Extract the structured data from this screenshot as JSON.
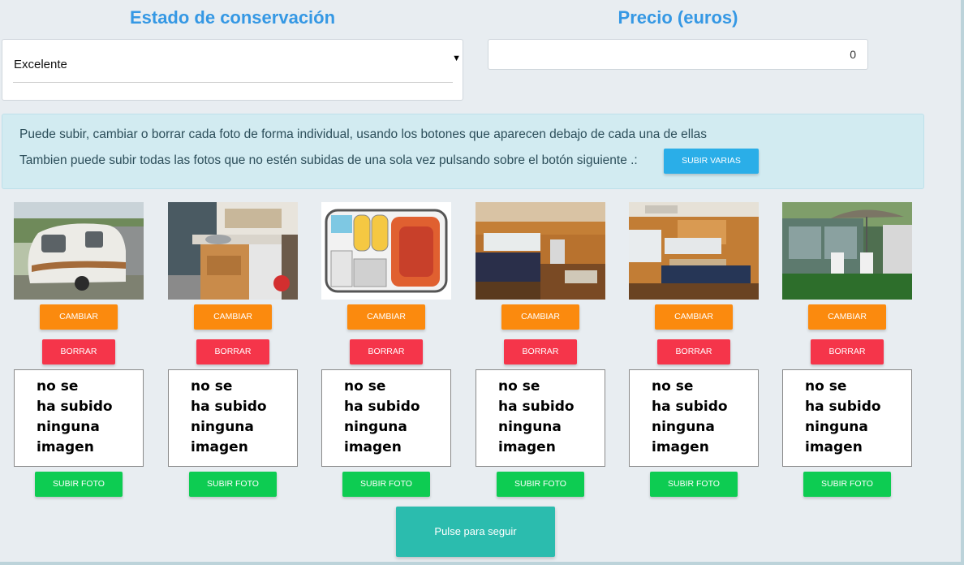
{
  "condition": {
    "title": "Estado de conservación",
    "selected": "Excelente"
  },
  "price": {
    "title": "Precio (euros)",
    "value": "0"
  },
  "info": {
    "line1": "Puede subir, cambiar o borrar cada foto de forma individual, usando los botones que aparecen debajo de cada una de ellas",
    "line2": "Tambien puede subir todas las fotos que no estén subidas de una sola vez pulsando sobre el botón siguiente .:",
    "upload_many_label": "SUBIR VARIAS"
  },
  "photos": [
    {
      "change_label": "CAMBIAR",
      "delete_label": "BORRAR"
    },
    {
      "change_label": "CAMBIAR",
      "delete_label": "BORRAR"
    },
    {
      "change_label": "CAMBIAR",
      "delete_label": "BORRAR"
    },
    {
      "change_label": "CAMBIAR",
      "delete_label": "BORRAR"
    },
    {
      "change_label": "CAMBIAR",
      "delete_label": "BORRAR"
    },
    {
      "change_label": "CAMBIAR",
      "delete_label": "BORRAR"
    }
  ],
  "placeholder": {
    "lines": [
      "no se",
      "ha subido",
      "ninguna",
      "imagen"
    ],
    "upload_label": "SUBIR FOTO"
  },
  "continue_label": "Pulse para seguir",
  "colors": {
    "title": "#3598e4",
    "change": "#fb8a0e",
    "delete": "#f5354a",
    "upload": "#0dcc52",
    "upload_many": "#2aaee8",
    "continue": "#2bbcae",
    "info_bg": "#d2ebf1"
  }
}
